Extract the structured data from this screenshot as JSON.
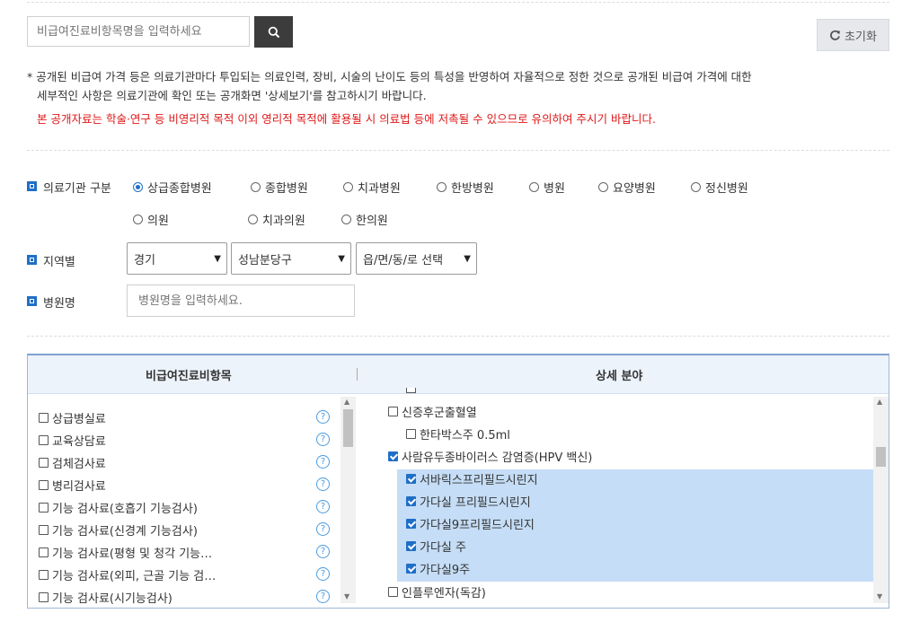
{
  "search": {
    "placeholder": "비급여진료비항목명을 입력하세요"
  },
  "reset_label": "초기화",
  "notice": {
    "line1": "* 공개된 비급여 가격 등은 의료기관마다 투입되는 의료인력, 장비, 시술의 난이도 등의 특성을 반영하여 자율적으로 정한 것으로 공개된 비급여 가격에 대한",
    "line2": "세부적인 사항은 의료기관에 확인 또는 공개화면 '상세보기'를 참고하시기 바랍니다.",
    "line3": "본 공개자료는 학술·연구 등 비영리적 목적 이외 영리적 목적에 활용될 시 의료법 등에 저촉될 수 있으므로 유의하여 주시기 바랍니다."
  },
  "filters": {
    "institution_label": "의료기관 구분",
    "institution_types": [
      "상급종합병원",
      "종합병원",
      "치과병원",
      "한방병원",
      "병원",
      "요양병원",
      "정신병원",
      "의원",
      "치과의원",
      "한의원"
    ],
    "institution_selected": "상급종합병원",
    "region_label": "지역별",
    "region_province": "경기",
    "region_district": "성남분당구",
    "region_town": "읍/면/동/로 선택",
    "hospital_label": "병원명",
    "hospital_placeholder": "병원명을 입력하세요."
  },
  "panel": {
    "left_header": "비급여진료비항목",
    "right_header": "상세 분야",
    "left_items": [
      "상급병실료",
      "교육상담료",
      "검체검사료",
      "병리검사료",
      "기능 검사료(호흡기 기능검사)",
      "기능 검사료(신경계 기능검사)",
      "기능 검사료(평형 및 청각 기능…",
      "기능 검사료(외피, 근골 기능 검…",
      "기능 검사료(시기능검사)"
    ],
    "right_items": [
      {
        "label": "신증후군출혈열",
        "checked": false,
        "level": 0
      },
      {
        "label": "한타박스주 0.5ml",
        "checked": false,
        "level": 1
      },
      {
        "label": "사람유두종바이러스 감염증(HPV 백신)",
        "checked": true,
        "level": 0
      },
      {
        "label": "서바릭스프리필드시린지",
        "checked": true,
        "level": 1
      },
      {
        "label": "가다실 프리필드시린지",
        "checked": true,
        "level": 1
      },
      {
        "label": "가다실9프리필드시린지",
        "checked": true,
        "level": 1
      },
      {
        "label": "가다실 주",
        "checked": true,
        "level": 1
      },
      {
        "label": "가다실9주",
        "checked": true,
        "level": 1
      },
      {
        "label": "인플루엔자(독감)",
        "checked": false,
        "level": 0
      }
    ]
  },
  "colors": {
    "accent": "#1f6fc7",
    "selection": "#c5ddf6",
    "warning": "#e01818"
  }
}
